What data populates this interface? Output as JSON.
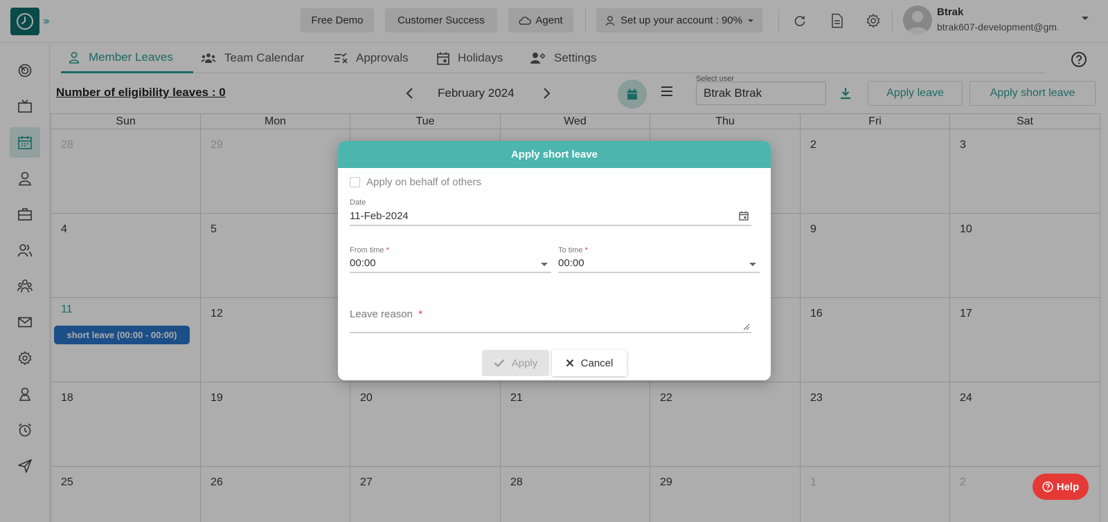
{
  "topbar": {
    "free_demo": "Free Demo",
    "customer_success": "Customer Success",
    "agent": "Agent",
    "setup_account": "Set up your account : 90%",
    "user_name": "Btrak",
    "user_email": "btrak607-development@gm..."
  },
  "tabs": [
    {
      "label": "Member Leaves",
      "icon": "person-icon"
    },
    {
      "label": "Team Calendar",
      "icon": "team-icon"
    },
    {
      "label": "Approvals",
      "icon": "approvals-icon"
    },
    {
      "label": "Holidays",
      "icon": "calendar-icon"
    },
    {
      "label": "Settings",
      "icon": "user-settings-icon"
    }
  ],
  "toolbar": {
    "eligibility": "Number of eligibility leaves : 0",
    "month": "February 2024",
    "select_user_label": "Select user",
    "select_user_value": "Btrak Btrak",
    "apply_leave": "Apply leave",
    "apply_short_leave": "Apply short leave"
  },
  "calendar": {
    "days": [
      "Sun",
      "Mon",
      "Tue",
      "Wed",
      "Thu",
      "Fri",
      "Sat"
    ],
    "weeks": [
      [
        "28",
        "29",
        "",
        "",
        "",
        "2",
        "3"
      ],
      [
        "4",
        "5",
        "",
        "",
        "",
        "9",
        "10"
      ],
      [
        "11",
        "12",
        "",
        "",
        "",
        "16",
        "17"
      ],
      [
        "18",
        "19",
        "20",
        "21",
        "22",
        "23",
        "24"
      ],
      [
        "25",
        "26",
        "27",
        "28",
        "29",
        "1",
        "2"
      ]
    ],
    "event": "short leave (00:00 - 00:00)"
  },
  "modal": {
    "title": "Apply short leave",
    "behalf_label": "Apply on behalf of others",
    "date_label": "Date",
    "date_value": "11-Feb-2024",
    "from_label": "From time",
    "from_value": "00:00",
    "to_label": "To time",
    "to_value": "00:00",
    "reason_label": "Leave reason",
    "required_mark": "*",
    "apply": "Apply",
    "cancel": "Cancel"
  },
  "help": "Help",
  "colors": {
    "accent": "#2a9d94",
    "modal_header": "#4bb5ae",
    "event_chip": "#2a73c9",
    "help": "#e53935"
  }
}
